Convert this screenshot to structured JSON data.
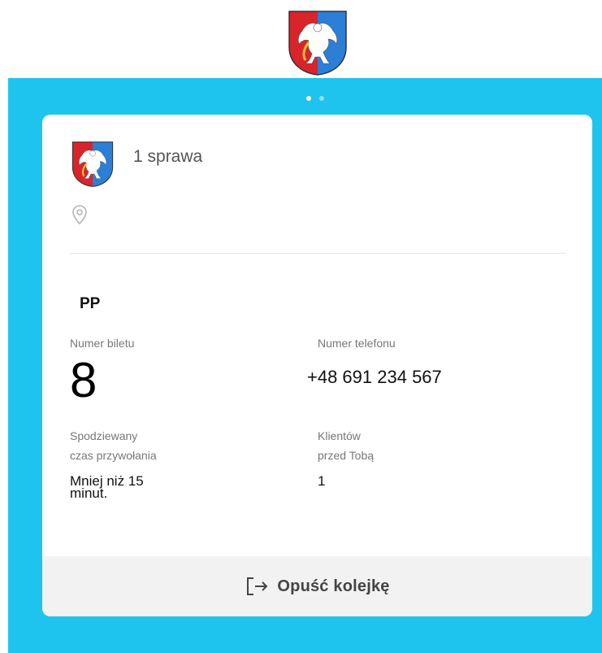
{
  "header": {
    "logo_icon": "coat-of-arms-icon",
    "carousel": {
      "total": 2,
      "active": 1
    }
  },
  "colors": {
    "background_blue": "#1fc4ee",
    "card": "#ffffff",
    "footer_bg": "#f2f2f2"
  },
  "ticket": {
    "service_title": "1 sprawa",
    "location_icon": "map-pin-icon",
    "category": "PP",
    "ticket_number_label": "Numer biletu",
    "ticket_number": "8",
    "phone_label": "Numer telefonu",
    "phone": "+48 691 234 567",
    "wait_label_line1": "Spodziewany",
    "wait_label_line2": "czas przywołania",
    "wait_value_line1": "Mniej niż 15",
    "wait_value_line2": "minut.",
    "clients_label_line1": "Klientów",
    "clients_label_line2": "przed Tobą",
    "clients_value": "1"
  },
  "footer": {
    "leave_icon": "exit-icon",
    "leave_label": "Opuść kolejkę"
  }
}
